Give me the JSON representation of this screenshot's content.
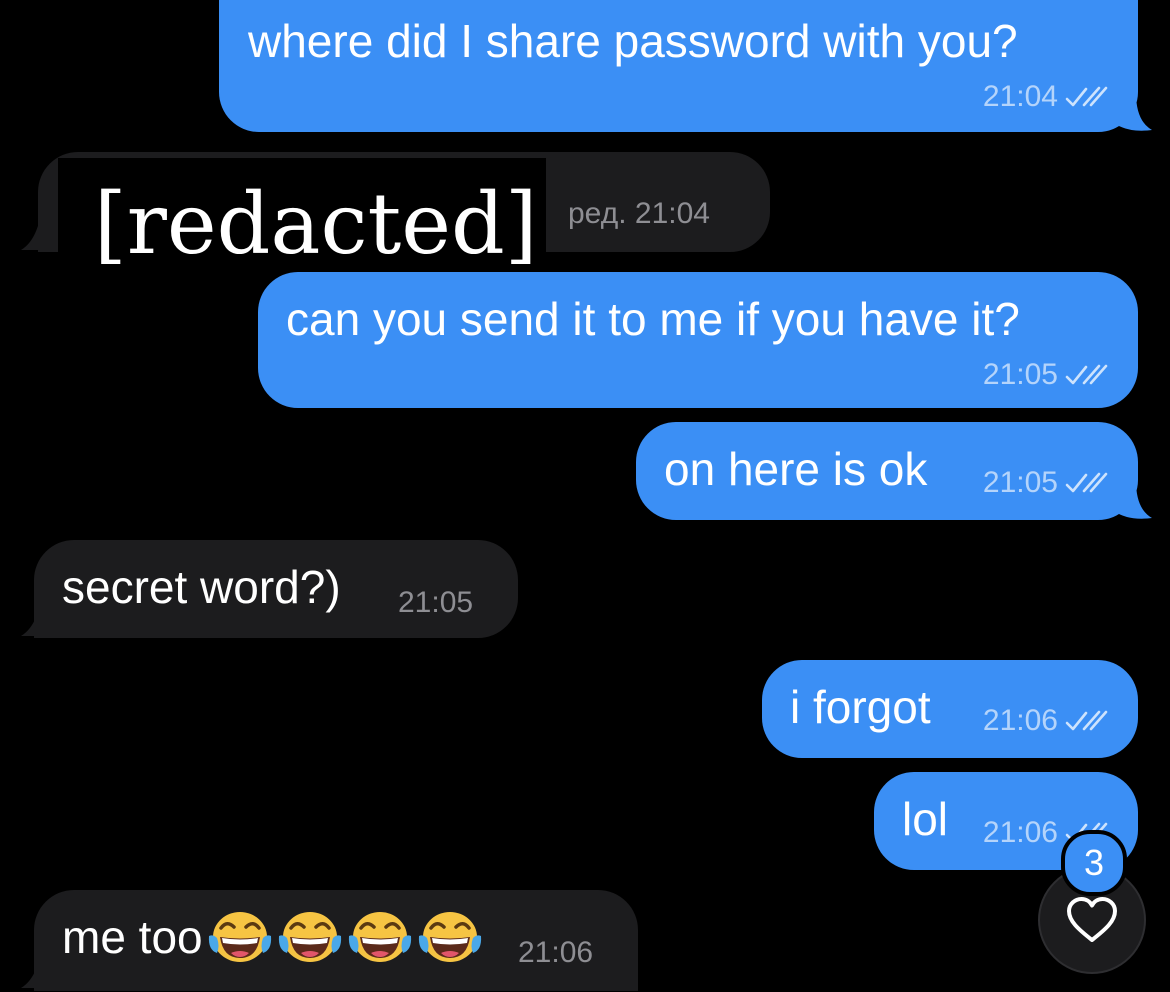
{
  "colors": {
    "background": "#000000",
    "outgoing_bubble": "#3b8ff5",
    "incoming_bubble": "#1c1c1e",
    "incoming_meta": "#8e8e93"
  },
  "messages": [
    {
      "direction": "outgoing",
      "text": "where did I share password with you?",
      "time": "21:04",
      "status": "read-double-check-icon"
    },
    {
      "direction": "incoming",
      "text": "[redacted]",
      "edited_time": "ред. 21:04"
    },
    {
      "direction": "outgoing",
      "text": "can you send it to me if you have it?",
      "time": "21:05",
      "status": "read-double-check-icon"
    },
    {
      "direction": "outgoing",
      "text": "on here is ok",
      "time": "21:05",
      "status": "read-double-check-icon"
    },
    {
      "direction": "incoming",
      "text": "secret word?)",
      "time": "21:05"
    },
    {
      "direction": "outgoing",
      "text": "i forgot",
      "time": "21:06",
      "status": "read-double-check-icon"
    },
    {
      "direction": "outgoing",
      "text": "lol",
      "time": "21:06",
      "status": "read-double-check-icon"
    },
    {
      "direction": "incoming",
      "text": "me too",
      "emoji": [
        "face-with-tears-of-joy-icon",
        "face-with-tears-of-joy-icon",
        "face-with-tears-of-joy-icon",
        "face-with-tears-of-joy-icon"
      ],
      "time": "21:06"
    }
  ],
  "reaction_button": {
    "icon": "heart-icon",
    "badge_count": "3"
  }
}
